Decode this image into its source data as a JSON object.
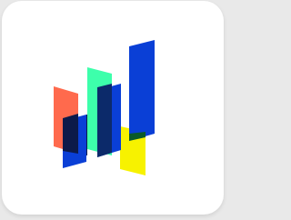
{
  "app_icon": {
    "name": "chart-app-icon",
    "background": "#ffffff",
    "logo": {
      "icon": "bar-chart-icon",
      "colors": {
        "coral": "#ff6a4d",
        "mint": "#3dffab",
        "blue": "#0a3fd6",
        "yellow": "#f7f200",
        "overlap_dark": "#0c1a4a",
        "overlap_green": "#0a5a2a"
      }
    }
  }
}
